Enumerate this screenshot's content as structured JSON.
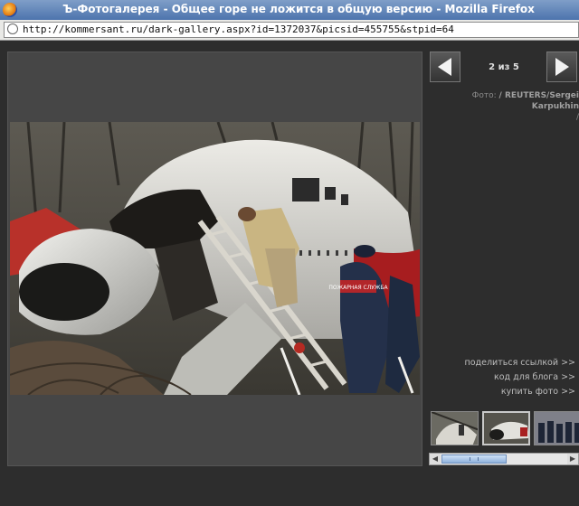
{
  "window": {
    "title": "Ъ-Фотогалерея - Общее горе не ложится в общую версию - Mozilla Firefox"
  },
  "address_bar": {
    "url": "http://kommersant.ru/dark-gallery.aspx?id=1372037&picsid=455755&stpid=64"
  },
  "gallery": {
    "counter": "2 из 5",
    "credit_prefix": "Фото:",
    "credit_author": "/ REUTERS/Sergei Karpukhin",
    "credit_suffix": "/",
    "links": [
      "поделиться ссылкой >>",
      "код для блога >>",
      "купить фото >>"
    ],
    "photo_badge": "ПОЖАРНАЯ СЛУЖБА"
  },
  "colors": {
    "page_background": "#2d2d2d",
    "viewer_background": "#464646",
    "link_text": "#bdbdbd"
  },
  "icons": {
    "prev": "arrow-left-icon",
    "next": "arrow-right-icon",
    "address": "globe-icon"
  }
}
